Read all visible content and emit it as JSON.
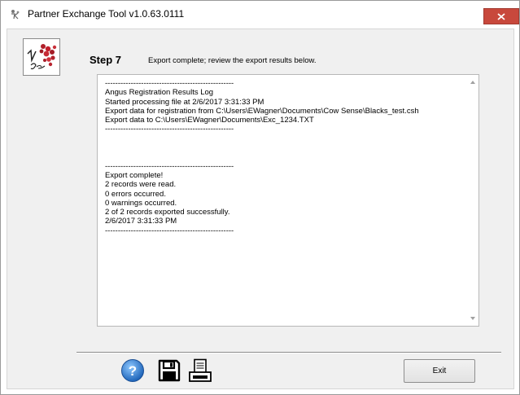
{
  "window": {
    "title": "Partner Exchange Tool v1.0.63.0111",
    "app_icon": "app-icon",
    "close_icon": "close-icon"
  },
  "header": {
    "logo_icon": "company-logo",
    "step_title": "Step 7",
    "step_description": "Export complete; review the export results below."
  },
  "log": {
    "lines": [
      "--------------------------------------------------",
      "Angus Registration Results Log",
      "Started processing file at 2/6/2017 3:31:33 PM",
      "Export data for registration from C:\\Users\\EWagner\\Documents\\Cow Sense\\Blacks_test.csh",
      "Export data to C:\\Users\\EWagner\\Documents\\Exc_1234.TXT",
      "--------------------------------------------------",
      "",
      "",
      "",
      "--------------------------------------------------",
      "Export complete!",
      "2 records were read.",
      "0 errors occurred.",
      "0 warnings occurred.",
      "2 of 2 records exported successfully.",
      "2/6/2017 3:31:33 PM",
      "--------------------------------------------------"
    ]
  },
  "toolbar": {
    "help_icon": "help-icon",
    "save_icon": "save-icon",
    "print_icon": "print-icon",
    "exit_label": "Exit"
  },
  "colors": {
    "close_button": "#c8483c",
    "help_blue": "#2f7fd1",
    "dialog_background": "#f0f0f0"
  }
}
